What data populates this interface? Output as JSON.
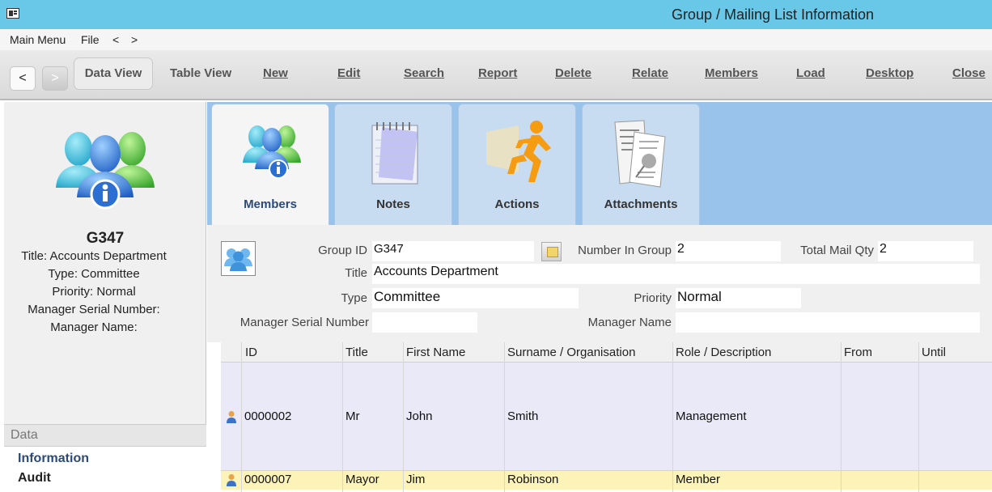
{
  "window": {
    "title": "Group / Mailing List Information"
  },
  "menu": {
    "main_menu": "Main Menu",
    "file": "File",
    "back": "<",
    "forward": ">"
  },
  "toolbar": {
    "back": "<",
    "forward": ">",
    "data_view": "Data View",
    "table_view": "Table View",
    "new": "New",
    "edit": "Edit",
    "search": "Search",
    "report": "Report",
    "delete": "Delete",
    "relate": "Relate",
    "members": "Members",
    "load": "Load",
    "desktop": "Desktop",
    "close": "Close"
  },
  "summary": {
    "code": "G347",
    "title_line": "Title: Accounts Department",
    "type_line": "Type: Committee",
    "priority_line": "Priority: Normal",
    "manager_serial_line": "Manager Serial Number:",
    "manager_name_line": "Manager Name:"
  },
  "data_section": {
    "heading": "Data",
    "information": "Information",
    "audit": "Audit"
  },
  "tabs": [
    {
      "label": "Members",
      "icon": "members-icon"
    },
    {
      "label": "Notes",
      "icon": "notepad-icon"
    },
    {
      "label": "Actions",
      "icon": "running-man-icon"
    },
    {
      "label": "Attachments",
      "icon": "attachments-icon"
    }
  ],
  "form": {
    "group_id_label": "Group ID",
    "group_id": "G347",
    "number_in_group_label": "Number In Group",
    "number_in_group": "2",
    "total_mail_qty_label": "Total Mail Qty",
    "total_mail_qty": "2",
    "title_label": "Title",
    "title": "Accounts Department",
    "type_label": "Type",
    "type": "Committee",
    "priority_label": "Priority",
    "priority": "Normal",
    "manager_serial_label": "Manager Serial Number",
    "manager_serial": "",
    "manager_name_label": "Manager Name",
    "manager_name": ""
  },
  "table": {
    "columns": [
      "ID",
      "Title",
      "First Name",
      "Surname / Organisation",
      "Role / Description",
      "From",
      "Until"
    ],
    "rows": [
      {
        "id": "0000002",
        "title": "Mr",
        "first_name": "John",
        "surname": "Smith",
        "role": "Management",
        "from": "",
        "until": ""
      },
      {
        "id": "0000007",
        "title": "Mayor",
        "first_name": "Jim",
        "surname": "Robinson",
        "role": "Member",
        "from": "",
        "until": ""
      }
    ]
  },
  "colors": {
    "titlebar": "#69c8e8",
    "tabstrip": "#99c3ea",
    "tab": "#c7dcf1",
    "row_selected": "#fbf3b7",
    "row_alt": "#e9e9f7"
  }
}
